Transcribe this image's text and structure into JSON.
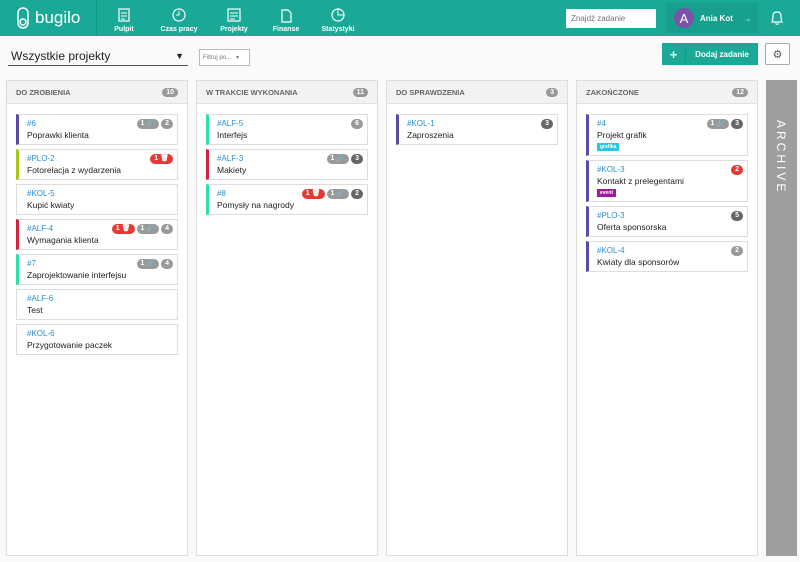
{
  "app": {
    "name": "bugilo"
  },
  "nav": [
    {
      "label": "Pulpit",
      "icon": "clipboard-icon"
    },
    {
      "label": "Czas pracy",
      "icon": "clock-icon"
    },
    {
      "label": "Projekty",
      "icon": "document-icon"
    },
    {
      "label": "Finanse",
      "icon": "files-icon"
    },
    {
      "label": "Statystyki",
      "icon": "pie-chart-icon"
    }
  ],
  "search": {
    "placeholder": "Znajdź zadanie"
  },
  "user": {
    "initial": "A",
    "name": "Ania Kot"
  },
  "toolbar": {
    "project": "Wszystkie projekty",
    "filter": "Filtruj po...",
    "add": "Dodaj zadanie"
  },
  "archive": "ARCHIVE",
  "colors": {
    "teal": "#1aa996",
    "purple": "#5b4aa3",
    "lime": "#a6c81d",
    "red": "#d0243c",
    "mint": "#2de0a5"
  },
  "columns": [
    {
      "title": "DO ZROBIENIA",
      "count": "10",
      "cards": [
        {
          "id": "#6",
          "title": "Poprawki klienta",
          "accent": "#5b4aa3",
          "badges": [
            {
              "t": "1 🔗",
              "c": "g"
            },
            {
              "t": "2",
              "c": "g"
            }
          ]
        },
        {
          "id": "#PLO-2",
          "title": "Fotorelacja z wydarzenia",
          "accent": "#a6c81d",
          "badges": [
            {
              "t": "1 🗑",
              "c": "r"
            }
          ]
        },
        {
          "id": "#KOL-5",
          "title": "Kupić kwiaty",
          "accent": "",
          "badges": []
        },
        {
          "id": "#ALF-4",
          "title": "Wymagania klienta",
          "accent": "#d0243c",
          "badges": [
            {
              "t": "1 🗑",
              "c": "r"
            },
            {
              "t": "1 🔗",
              "c": "g"
            },
            {
              "t": "4",
              "c": "g"
            }
          ]
        },
        {
          "id": "#7",
          "title": "Zaprojektowanie interfejsu",
          "accent": "#2de0a5",
          "badges": [
            {
              "t": "1 🔗",
              "c": "g"
            },
            {
              "t": "4",
              "c": "g"
            }
          ]
        },
        {
          "id": "#ALF-6",
          "title": "Test",
          "accent": "",
          "badges": []
        },
        {
          "id": "#KOL-6",
          "title": "Przygotowanie paczek",
          "accent": "",
          "badges": []
        }
      ]
    },
    {
      "title": "W TRAKCIE WYKONANIA",
      "count": "11",
      "cards": [
        {
          "id": "#ALF-5",
          "title": "Interfejs",
          "accent": "#2de0a5",
          "badges": [
            {
              "t": "6",
              "c": "g"
            }
          ]
        },
        {
          "id": "#ALF-3",
          "title": "Makiety",
          "accent": "#d0243c",
          "badges": [
            {
              "t": "1 🔗",
              "c": "g"
            },
            {
              "t": "3",
              "c": "d"
            }
          ]
        },
        {
          "id": "#8",
          "title": "Pomysły na nagrody",
          "accent": "#2de0a5",
          "badges": [
            {
              "t": "1 🗑",
              "c": "r"
            },
            {
              "t": "1 🔗",
              "c": "g"
            },
            {
              "t": "2",
              "c": "d"
            }
          ]
        }
      ]
    },
    {
      "title": "DO SPRAWDZENIA",
      "count": "3",
      "cards": [
        {
          "id": "#KOL-1",
          "title": "Zaproszenia",
          "accent": "#5b4aa3",
          "badges": [
            {
              "t": "3",
              "c": "d"
            }
          ]
        }
      ]
    },
    {
      "title": "ZAKOŃCZONE",
      "count": "12",
      "cards": [
        {
          "id": "#4",
          "title": "Projekt grafik",
          "accent": "#5b4aa3",
          "tag": "grafika",
          "tagColor": "#28c8e0",
          "badges": [
            {
              "t": "1 🔗",
              "c": "g"
            },
            {
              "t": "3",
              "c": "d"
            }
          ]
        },
        {
          "id": "#KOL-3",
          "title": "Kontakt z prelegentami",
          "accent": "#5b4aa3",
          "tag": "event",
          "tagColor": "#a0199e",
          "badges": [
            {
              "t": "2",
              "c": "r"
            }
          ]
        },
        {
          "id": "#PLO-3",
          "title": "Oferta sponsorska",
          "accent": "#5b4aa3",
          "badges": [
            {
              "t": "5",
              "c": "d"
            }
          ]
        },
        {
          "id": "#KOL-4",
          "title": "Kwiaty dla sponsorów",
          "accent": "#5b4aa3",
          "badges": [
            {
              "t": "2",
              "c": "g"
            }
          ]
        }
      ]
    }
  ]
}
